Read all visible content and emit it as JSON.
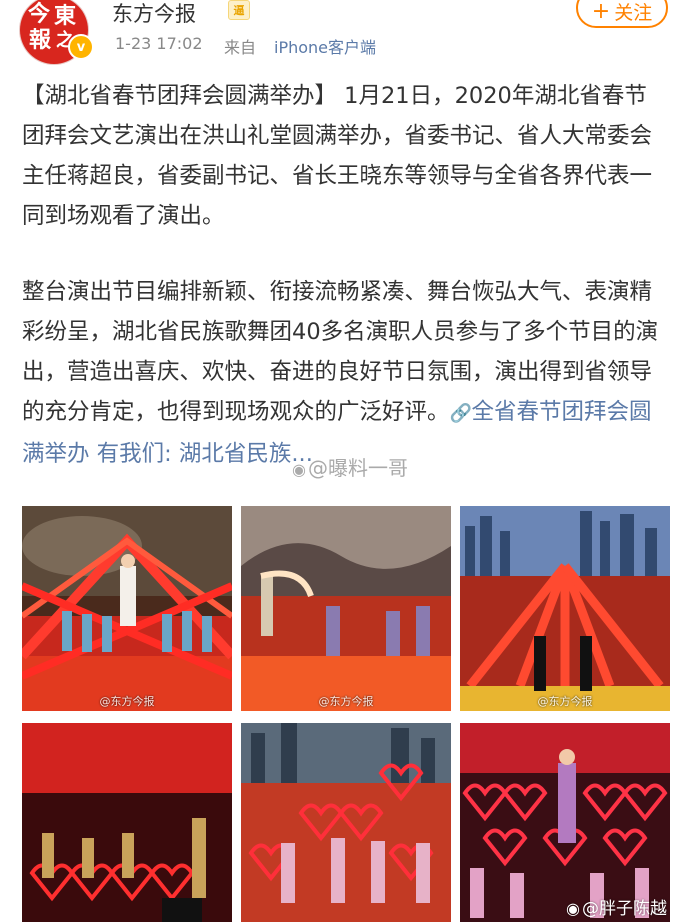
{
  "header": {
    "avatar_chars": [
      "今",
      "東",
      "報",
      "之"
    ],
    "verified_mark": "v",
    "user_name": "东方今报",
    "vip_badge": "逼",
    "time": "1-23 17:02",
    "source_prefix": "来自",
    "source": "iPhone客户端",
    "follow_label": "关注",
    "follow_plus": "+"
  },
  "post": {
    "paragraph1": "【湖北省春节团拜会圆满举办】 1月21日，2020年湖北省春节团拜会文艺演出在洪山礼堂圆满举办，省委书记、省人大常委会主任蒋超良，省委副书记、省长王晓东等领导与全省各界代表一同到场观看了演出。",
    "paragraph2": "整台演出节目编排新颖、衔接流畅紧凑、舞台恢弘大气、表演精彩纷呈，湖北省民族歌舞团40多名演职人员参与了多个节目的演出，营造出喜庆、欢快、奋进的良好节日氛围，演出得到省领导的充分肯定，也得到现场观众的广泛好评。",
    "link_text": "全省春节团拜会圆满举办",
    "link_tail": " 有我们: 湖北省民族...",
    "link_icon": "🔗"
  },
  "gallery": {
    "captions": [
      "@东方今报",
      "@东方今报",
      "@东方今报"
    ]
  },
  "watermarks": {
    "middle_eye": "◉",
    "middle": "@曝料一哥",
    "bottom_eye": "◉",
    "bottom": "@胖子陈越"
  },
  "colors": {
    "follow": "#ff8200",
    "link": "#5b7aa8",
    "avatar": "#d8261e",
    "verified": "#ffb400"
  }
}
